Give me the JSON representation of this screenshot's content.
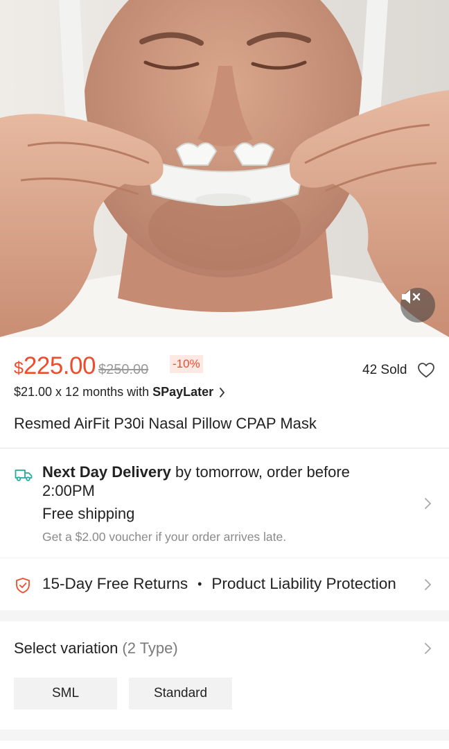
{
  "media": {
    "mute_icon": "speaker-muted-icon"
  },
  "pricing": {
    "currency": "$",
    "price": "225.00",
    "original_price": "$250.00",
    "discount": "-10%",
    "sold": "42 Sold",
    "installment_text": "$21.00 x 12 months with",
    "installment_provider": "SPayLater",
    "accent_color": "#ee4d2d"
  },
  "product": {
    "title": "Resmed AirFit P30i Nasal Pillow CPAP Mask"
  },
  "delivery": {
    "icon": "truck-icon",
    "headline_bold": "Next Day Delivery",
    "headline_rest": " by tomorrow, order before 2:00PM",
    "free_shipping": "Free shipping",
    "voucher_note": "Get a $2.00 voucher if your order arrives late.",
    "icon_color": "#26aa99"
  },
  "returns": {
    "icon": "shield-check-icon",
    "returns_label": "15-Day Free Returns",
    "separator": "•",
    "protection_label": "Product Liability Protection"
  },
  "variation": {
    "title": "Select variation",
    "count": "(2 Type)",
    "options": [
      "SML",
      "Standard"
    ]
  }
}
